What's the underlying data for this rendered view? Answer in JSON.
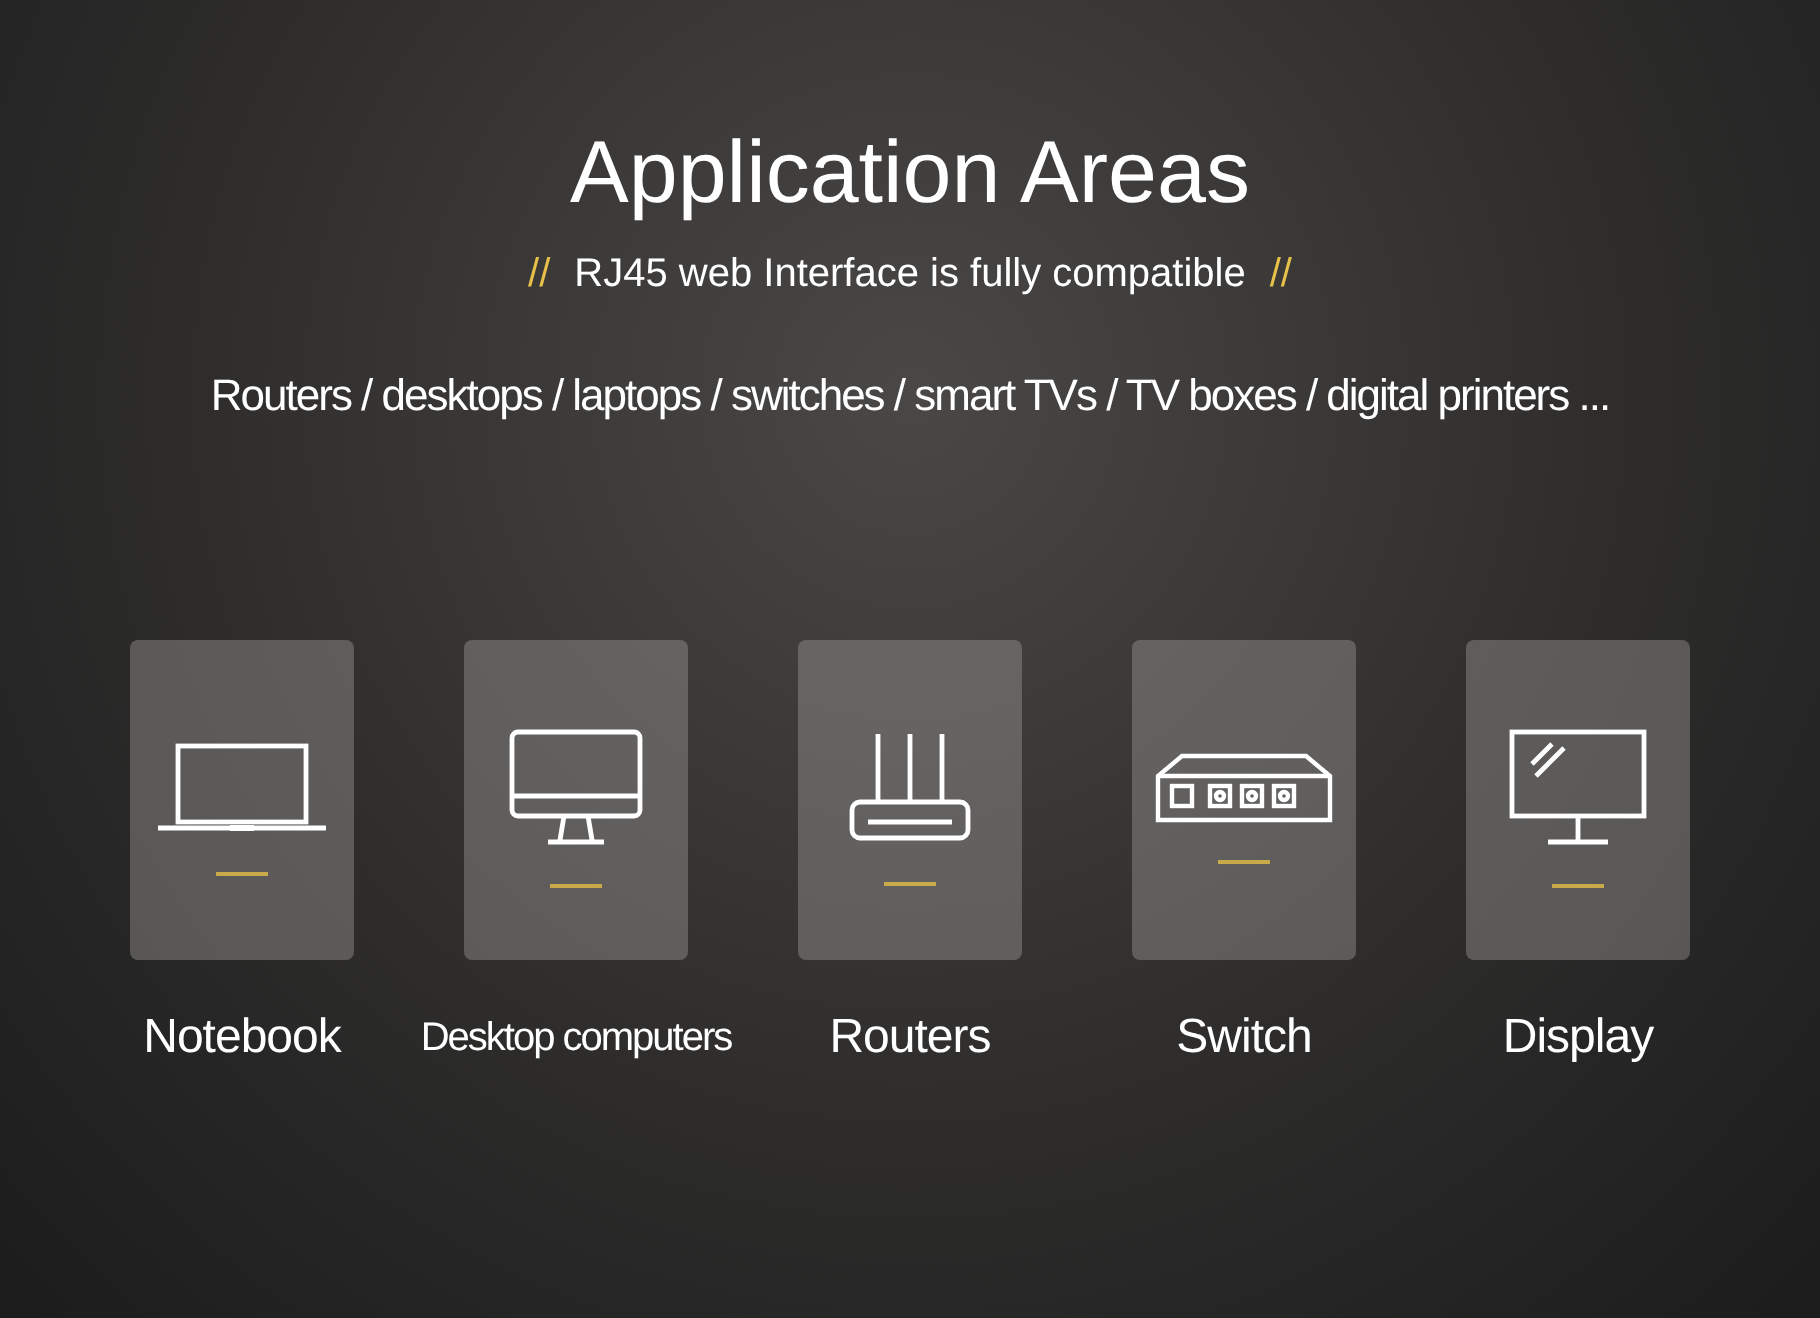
{
  "title": "Application Areas",
  "subtitle": {
    "mark_left": "//",
    "text": "RJ45 web Interface is fully compatible",
    "mark_right": "//"
  },
  "devices_line": "Routers / desktops / laptops / switches / smart TVs / TV boxes / digital printers ...",
  "areas": [
    {
      "kind": "laptop",
      "label": "Notebook"
    },
    {
      "kind": "monitor",
      "label": "Desktop computers"
    },
    {
      "kind": "router",
      "label": "Routers"
    },
    {
      "kind": "switch",
      "label": "Switch"
    },
    {
      "kind": "display",
      "label": "Display"
    }
  ]
}
